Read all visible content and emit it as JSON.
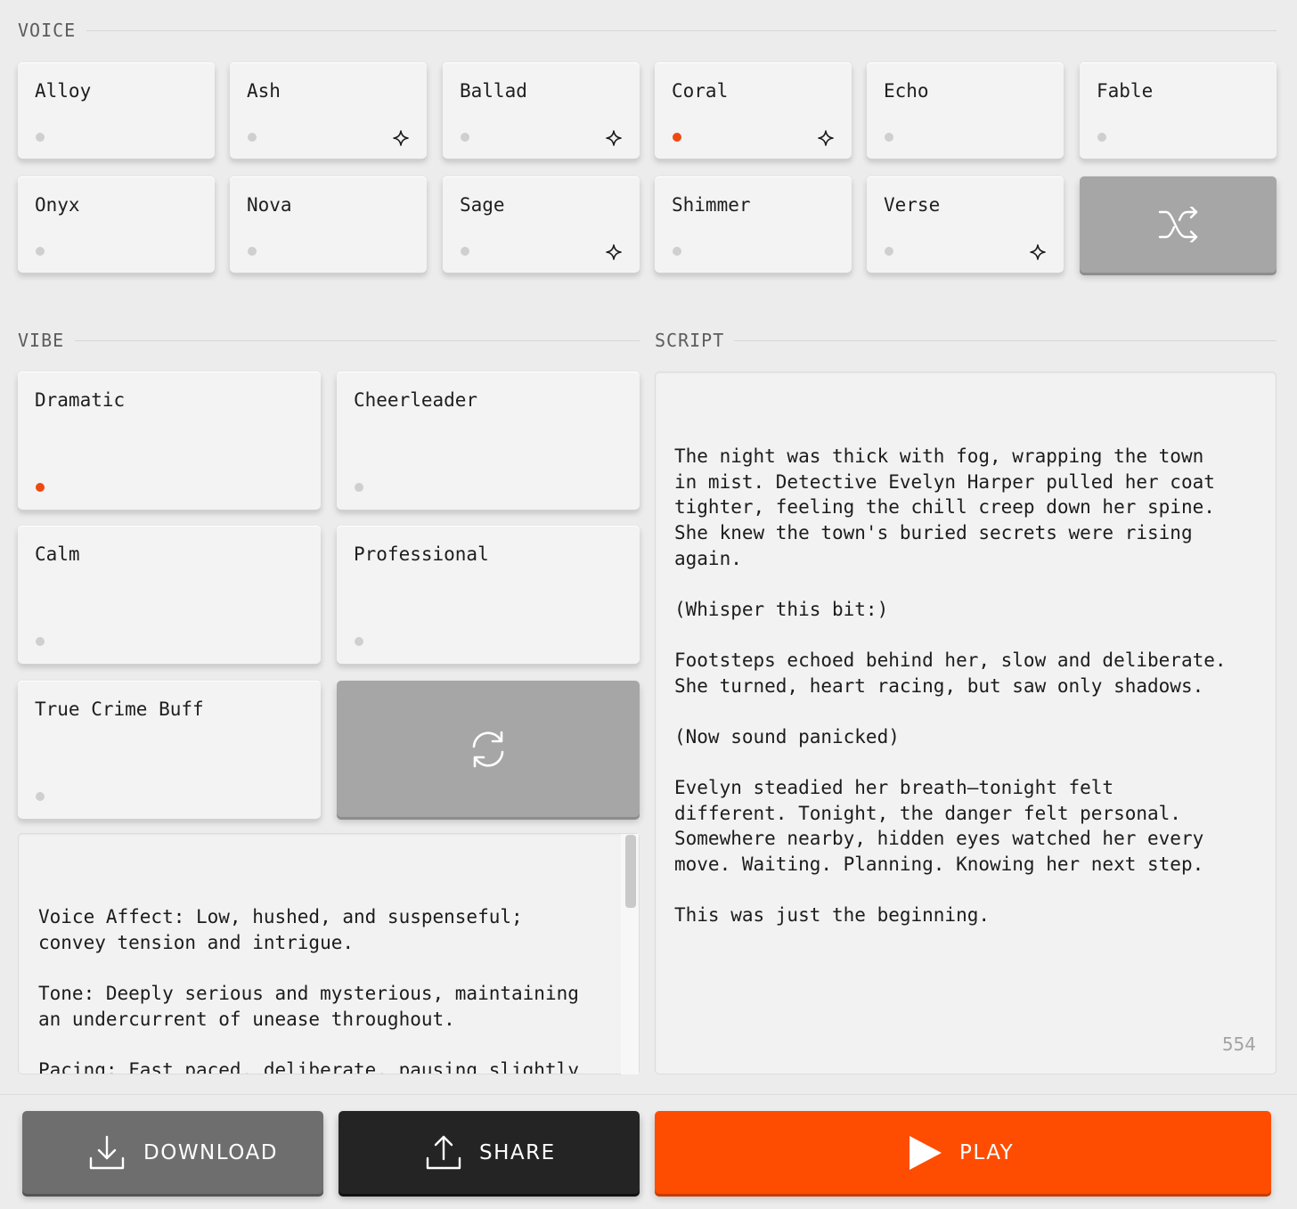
{
  "sections": {
    "voice": "VOICE",
    "vibe": "VIBE",
    "script": "SCRIPT"
  },
  "voices": [
    {
      "name": "Alloy",
      "selected": false,
      "star": false
    },
    {
      "name": "Ash",
      "selected": false,
      "star": true
    },
    {
      "name": "Ballad",
      "selected": false,
      "star": true
    },
    {
      "name": "Coral",
      "selected": true,
      "star": true
    },
    {
      "name": "Echo",
      "selected": false,
      "star": false
    },
    {
      "name": "Fable",
      "selected": false,
      "star": false
    },
    {
      "name": "Onyx",
      "selected": false,
      "star": false
    },
    {
      "name": "Nova",
      "selected": false,
      "star": false
    },
    {
      "name": "Sage",
      "selected": false,
      "star": true
    },
    {
      "name": "Shimmer",
      "selected": false,
      "star": false
    },
    {
      "name": "Verse",
      "selected": false,
      "star": true
    }
  ],
  "vibes": [
    {
      "name": "Dramatic",
      "selected": true
    },
    {
      "name": "Cheerleader",
      "selected": false
    },
    {
      "name": "Calm",
      "selected": false
    },
    {
      "name": "Professional",
      "selected": false
    },
    {
      "name": "True Crime Buff",
      "selected": false
    }
  ],
  "vibe_description": "Voice Affect: Low, hushed, and suspenseful;\nconvey tension and intrigue.\n\nTone: Deeply serious and mysterious, maintaining\nan undercurrent of unease throughout.\n\nPacing: Fast paced, deliberate, pausing slightly\nafter suspenseful moments to heighten drama.",
  "script_text": "The night was thick with fog, wrapping the town\nin mist. Detective Evelyn Harper pulled her coat\ntighter, feeling the chill creep down her spine.\nShe knew the town's buried secrets were rising\nagain.\n\n(Whisper this bit:)\n\nFootsteps echoed behind her, slow and deliberate.\nShe turned, heart racing, but saw only shadows.\n\n(Now sound panicked)\n\nEvelyn steadied her breath—tonight felt\ndifferent. Tonight, the danger felt personal.\nSomewhere nearby, hidden eyes watched her every\nmove. Waiting. Planning. Knowing her next step.\n\nThis was just the beginning.",
  "char_count": "554",
  "buttons": {
    "download": "DOWNLOAD",
    "share": "SHARE",
    "play": "PLAY"
  },
  "colors": {
    "accent": "#fe4d00",
    "dark": "#242424",
    "gray": "#6c6c6c",
    "selected_dot": "#ee4a10"
  },
  "icons": {
    "shuffle": "shuffle-icon",
    "refresh": "refresh-icon",
    "download": "download-icon",
    "share": "share-icon",
    "play": "play-icon",
    "star": "sparkle-icon"
  }
}
